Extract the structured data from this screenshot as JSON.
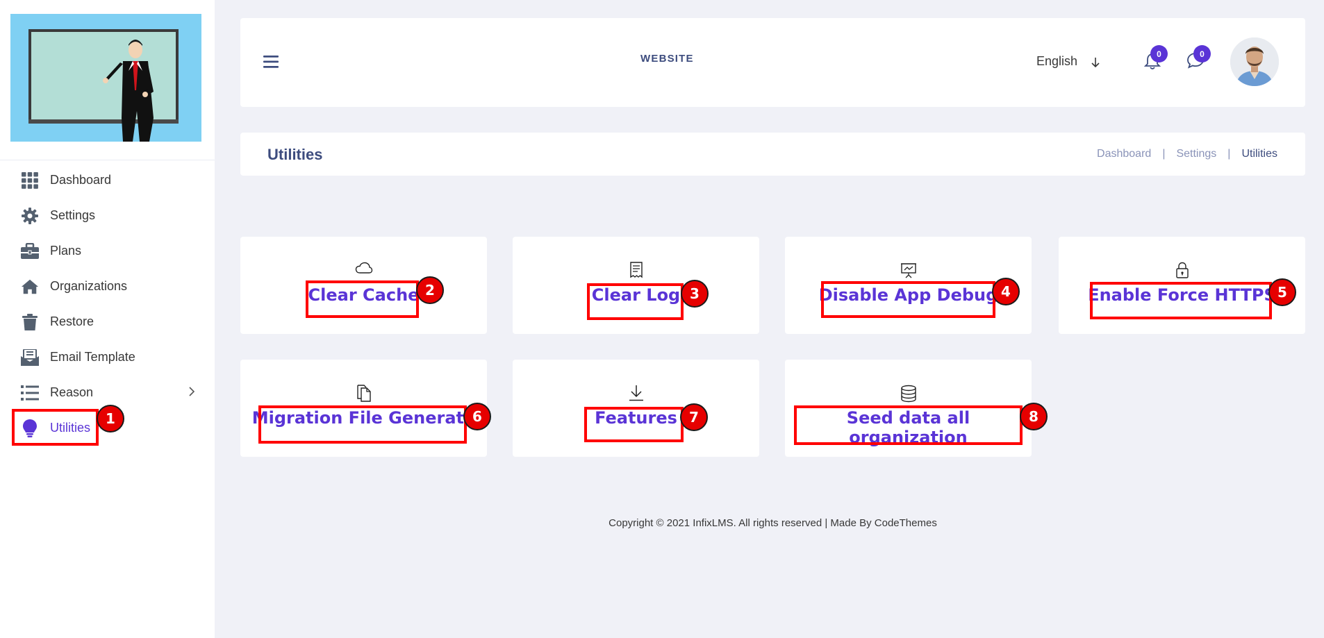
{
  "header": {
    "site_title": "WEBSITE",
    "language": "English",
    "notifications_count": "0",
    "messages_count": "0"
  },
  "sidebar": {
    "items": [
      {
        "label": "Dashboard",
        "icon": "grid-icon"
      },
      {
        "label": "Settings",
        "icon": "gear-icon"
      },
      {
        "label": "Plans",
        "icon": "briefcase-icon"
      },
      {
        "label": "Organizations",
        "icon": "home-icon"
      },
      {
        "label": "Restore",
        "icon": "trash-icon"
      },
      {
        "label": "Email Template",
        "icon": "envelope-icon"
      },
      {
        "label": "Reason",
        "icon": "list-icon"
      },
      {
        "label": "Utilities",
        "icon": "lightbulb-icon"
      }
    ]
  },
  "page": {
    "title": "Utilities",
    "breadcrumb": [
      "Dashboard",
      "Settings",
      "Utilities"
    ]
  },
  "utilities": [
    {
      "label": "Clear Cache",
      "icon": "cloud-icon"
    },
    {
      "label": "Clear Log",
      "icon": "receipt-icon"
    },
    {
      "label": "Disable App Debug",
      "icon": "presentation-icon"
    },
    {
      "label": "Enable Force HTTPS",
      "icon": "lock-icon"
    },
    {
      "label": "Migration File Generate",
      "icon": "copy-file-icon"
    },
    {
      "label": "Features",
      "icon": "download-icon"
    },
    {
      "label": "Seed data all organization",
      "icon": "database-icon"
    }
  ],
  "annotations": [
    "1",
    "2",
    "3",
    "4",
    "5",
    "6",
    "7",
    "8"
  ],
  "colors": {
    "accent": "#5a34d6",
    "title": "#3d4c7e",
    "annotation": "#ff0000",
    "background": "#f0f1f7"
  },
  "footer": {
    "text": "Copyright © 2021 InfixLMS. All rights reserved | Made By CodeThemes"
  }
}
